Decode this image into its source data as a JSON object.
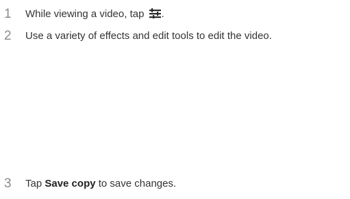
{
  "steps": [
    {
      "number": "1",
      "text_before": "While viewing a video, tap ",
      "icon": "edit-adjust-icon",
      "text_after": "."
    },
    {
      "number": "2",
      "text": "Use a variety of effects and edit tools to edit the video."
    },
    {
      "number": "3",
      "text_before": "Tap ",
      "bold": "Save copy",
      "text_after": " to save changes."
    }
  ],
  "colors": {
    "number": "#8a8a8a",
    "text": "#333333",
    "bold": "#222222"
  }
}
